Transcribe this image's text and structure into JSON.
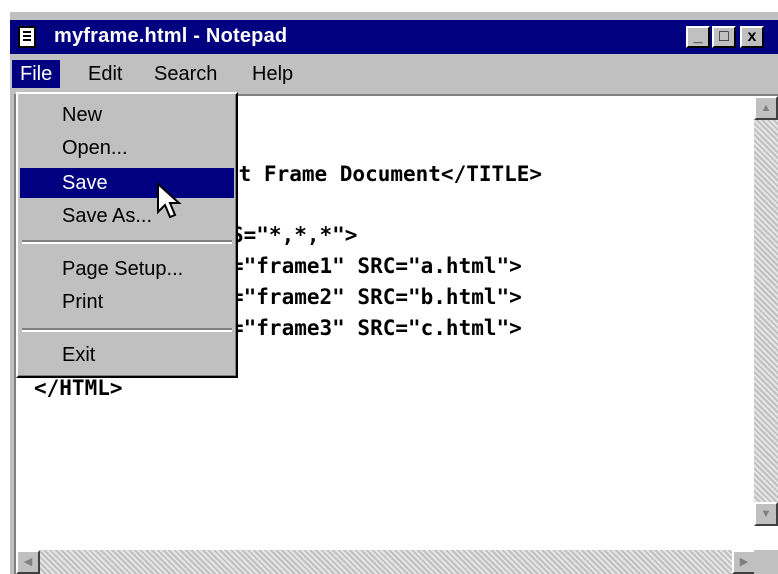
{
  "window": {
    "title": "myframe.html - Notepad",
    "controls": {
      "minimize": "_",
      "maximize": "□",
      "close": "x"
    }
  },
  "menubar": [
    {
      "label": "File"
    },
    {
      "label": "Edit"
    },
    {
      "label": "Search"
    },
    {
      "label": "Help"
    }
  ],
  "file_menu": {
    "items": [
      "New",
      "Open...",
      "Save",
      "Save As...",
      "Page Setup...",
      "Print",
      "Exit"
    ],
    "selected": "Save"
  },
  "editor": {
    "visible_lines": [
      "st Frame Document</TITLE>",
      "S=\"*,*,*\">",
      "=\"frame1\" SRC=\"a.html\">",
      "=\"frame2\" SRC=\"b.html\">",
      "=\"frame3\" SRC=\"c.html\">",
      "</HTML>"
    ]
  },
  "scrollbar": {
    "up": "▲",
    "down": "▼",
    "left": "◀",
    "right": "▶"
  },
  "colors": {
    "titlebar": "#000080",
    "selection": "#000080",
    "chrome": "#c0c0c0"
  }
}
